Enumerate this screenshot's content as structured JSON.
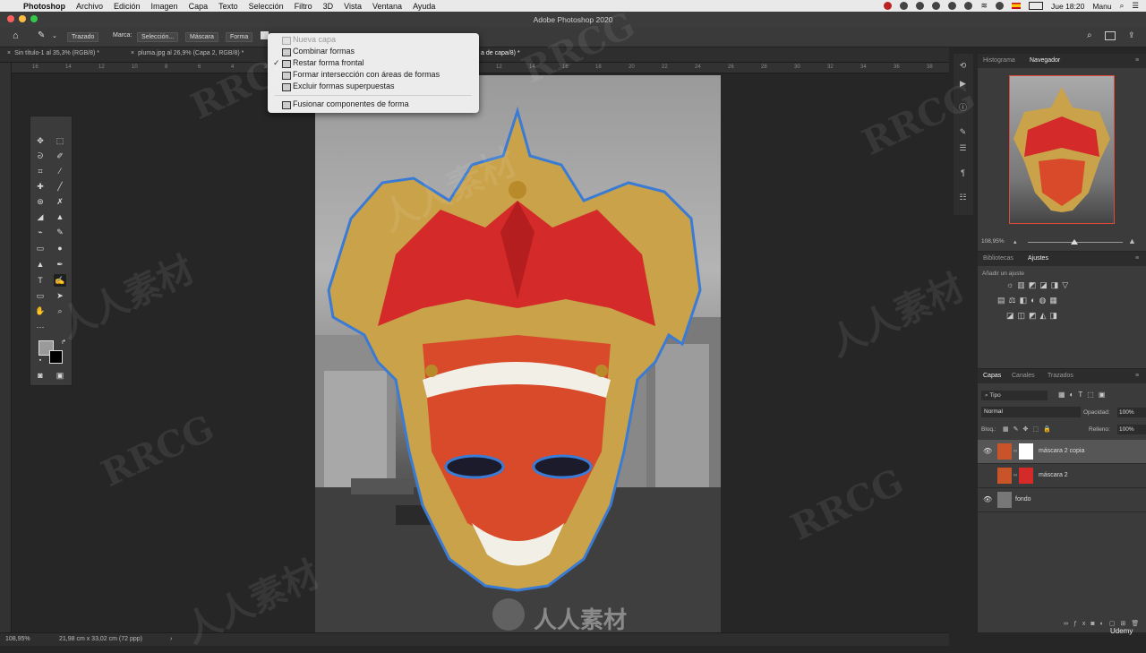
{
  "menubar": {
    "app": "Photoshop",
    "items": [
      "Archivo",
      "Edición",
      "Imagen",
      "Capa",
      "Texto",
      "Selección",
      "Filtro",
      "3D",
      "Vista",
      "Ventana",
      "Ayuda"
    ],
    "clock": "Jue 18:20",
    "user": "Manu"
  },
  "window": {
    "title": "Adobe Photoshop 2020"
  },
  "options": {
    "trazado": "Trazado",
    "marca": "Marca:",
    "seleccion": "Selección...",
    "mascara": "Máscara",
    "forma": "Forma"
  },
  "tabs": [
    {
      "label": "Sin título-1 al 35,3% (RGB/8) *"
    },
    {
      "label": "pluma.jpg al 26,9% (Capa 2, RGB/8) *"
    },
    {
      "label": "a de capa/8) *"
    }
  ],
  "ruler_ticks": [
    "16",
    "14",
    "12",
    "10",
    "8",
    "6",
    "4",
    "2",
    "0",
    "2",
    "4",
    "6",
    "8",
    "10",
    "12",
    "14",
    "16",
    "18",
    "20",
    "22",
    "24",
    "26",
    "28",
    "30",
    "32",
    "34",
    "36",
    "38"
  ],
  "combo_menu": {
    "items": [
      {
        "label": "Nueva capa",
        "state": "disabled"
      },
      {
        "label": "Combinar formas",
        "state": "normal"
      },
      {
        "label": "Restar forma frontal",
        "state": "checked"
      },
      {
        "label": "Formar intersección con áreas de formas",
        "state": "normal"
      },
      {
        "label": "Excluir formas superpuestas",
        "state": "normal"
      },
      {
        "label": "Fusionar componentes de forma",
        "state": "normal"
      }
    ]
  },
  "navigator": {
    "tabs": [
      "Histograma",
      "Navegador"
    ],
    "zoom": "108,95%"
  },
  "adjustments": {
    "tabs": [
      "Bibliotecas",
      "Ajustes"
    ],
    "hint": "Añadir un ajuste"
  },
  "layers_panel": {
    "tabs": [
      "Capas",
      "Canales",
      "Trazados"
    ],
    "filter": "Tipo",
    "blend_mode": "Normal",
    "opacity_label": "Opacidad:",
    "opacity": "100%",
    "lock_label": "Bloq.:",
    "fill_label": "Relleno:",
    "fill": "100%",
    "layers": [
      {
        "name": "máscara 2 copia",
        "selected": true
      },
      {
        "name": "máscara 2",
        "selected": false
      },
      {
        "name": "fondo",
        "selected": false
      }
    ]
  },
  "status": {
    "zoom": "108,95%",
    "doc_info": "21,98 cm x 33,02 cm (72 ppp)"
  },
  "overlay": {
    "watermark_latin": "RRCG",
    "watermark_cjk": "人人素材",
    "udemy": "Udemy"
  },
  "colors": {
    "path_outline": "#3a7bd5",
    "mask_red": "#d42a2a",
    "mask_gold": "#c9a24a"
  }
}
